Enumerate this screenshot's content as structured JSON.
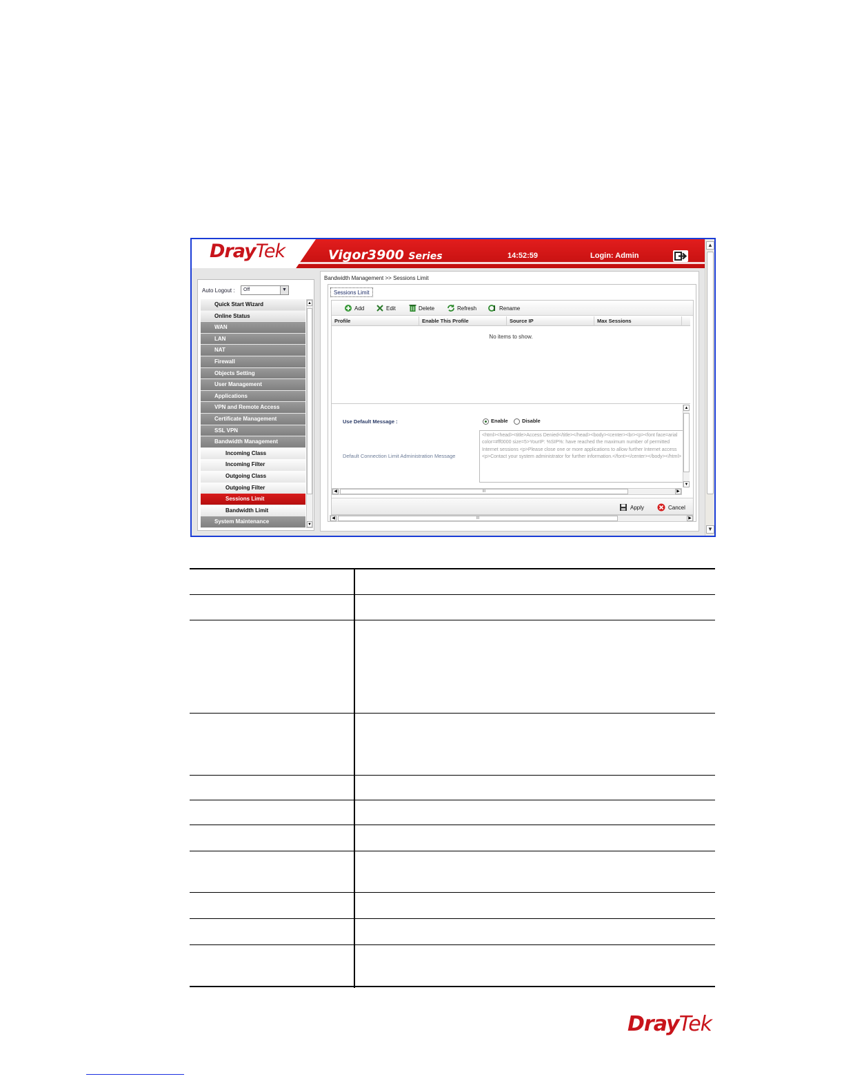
{
  "header": {
    "brand": "DrayTek",
    "brand_bold": "Dray",
    "brand_light": "Tek",
    "model": "Vigor3900",
    "series": "Series",
    "time": "14:52:59",
    "login": "Login: Admin"
  },
  "sidebar": {
    "auto_logout_label": "Auto Logout :",
    "auto_logout_value": "Off",
    "items": [
      {
        "label": "Quick Start Wizard",
        "style": "light"
      },
      {
        "label": "Online Status",
        "style": "light"
      },
      {
        "label": "WAN",
        "style": "dark"
      },
      {
        "label": "LAN",
        "style": "dark"
      },
      {
        "label": "NAT",
        "style": "dark"
      },
      {
        "label": "Firewall",
        "style": "dark"
      },
      {
        "label": "Objects Setting",
        "style": "dark"
      },
      {
        "label": "User Management",
        "style": "dark"
      },
      {
        "label": "Applications",
        "style": "dark"
      },
      {
        "label": "VPN and Remote Access",
        "style": "dark"
      },
      {
        "label": "Certificate Management",
        "style": "dark"
      },
      {
        "label": "SSL VPN",
        "style": "dark"
      },
      {
        "label": "Bandwidth Management",
        "style": "dark"
      },
      {
        "label": "Incoming Class",
        "style": "sub"
      },
      {
        "label": "Incoming Filter",
        "style": "sub"
      },
      {
        "label": "Outgoing Class",
        "style": "sub"
      },
      {
        "label": "Outgoing Filter",
        "style": "sub"
      },
      {
        "label": "Sessions Limit",
        "style": "active"
      },
      {
        "label": "Bandwidth Limit",
        "style": "sub"
      },
      {
        "label": "System Maintenance",
        "style": "dark"
      }
    ]
  },
  "main": {
    "breadcrumb": "Bandwidth Management >> Sessions Limit",
    "tab": "Sessions Limit",
    "toolbar": {
      "add": "Add",
      "edit": "Edit",
      "delete": "Delete",
      "refresh": "Refresh",
      "rename": "Rename"
    },
    "columns": [
      "Profile",
      "Enable This Profile",
      "Source IP",
      "Max Sessions"
    ],
    "empty_text": "No items to show.",
    "use_default_label": "Use Default Message :",
    "enable_label": "Enable",
    "disable_label": "Disable",
    "default_selected": "enable",
    "admin_msg_label": "Default Connection Limit Administration Message",
    "admin_msg_value": "<html><head><title>Access Denied</title></head><body><center><br><p><font face=arial color=#ff0000 size=5>YourIP: %SIP%: have reached the maximum number of permitted Internet sessions <p>Please close one or more applications to allow further Internet access <p>Contact your system administrator for further information.</font></center></body></html>",
    "scroll_mark": "III",
    "apply": "Apply",
    "cancel": "Cancel"
  },
  "footer": {
    "brand_bold": "Dray",
    "brand_light": "Tek"
  },
  "colors": {
    "brand_red": "#c8141b",
    "header_red": "#d41818",
    "active_menu": "#c51313",
    "menu_dark": "#8c8c8c"
  }
}
